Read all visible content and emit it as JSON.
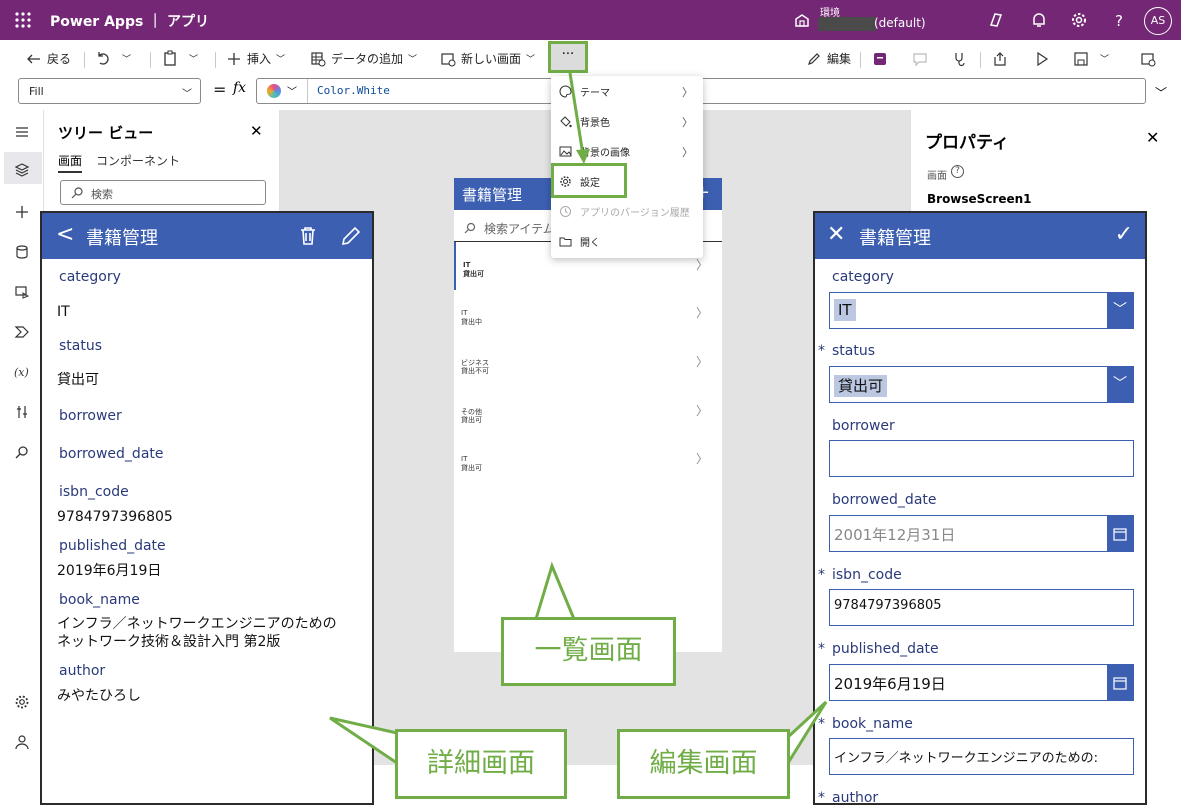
{
  "titlebar": {
    "brand": "Power Apps ｜ アプリ",
    "env_label": "環境",
    "env_name": "(default)",
    "avatar": "AS"
  },
  "commandbar": {
    "back": "戻る",
    "insert": "挿入",
    "add_data": "データの追加",
    "new_screen": "新しい画面",
    "more": "···",
    "edit": "編集"
  },
  "formula": {
    "property": "Fill",
    "equals": "=",
    "fx": "fx",
    "code": "Color.White"
  },
  "tree": {
    "title": "ツリー ビュー",
    "tab_screens": "画面",
    "tab_components": "コンポーネント",
    "search_placeholder": "検索"
  },
  "menu": {
    "items": [
      {
        "label": "テーマ",
        "icon": "palette-icon",
        "submenu": true
      },
      {
        "label": "背景色",
        "icon": "paint-bucket-icon",
        "submenu": true
      },
      {
        "label": "背景の画像",
        "icon": "image-icon",
        "submenu": true
      },
      {
        "label": "設定",
        "icon": "gear-icon",
        "submenu": false
      },
      {
        "label": "アプリのバージョン履歴",
        "icon": "history-icon",
        "submenu": false,
        "disabled": true
      },
      {
        "label": "開く",
        "icon": "folder-icon",
        "submenu": false
      }
    ]
  },
  "browse": {
    "title": "書籍管理",
    "search_placeholder": "検索アイテム",
    "rows": [
      {
        "category": "IT",
        "status": "貸出可"
      },
      {
        "category": "IT",
        "status": "貸出中"
      },
      {
        "category": "ビジネス",
        "status": "貸出不可"
      },
      {
        "category": "その他",
        "status": "貸出可"
      },
      {
        "category": "IT",
        "status": "貸出可"
      }
    ]
  },
  "props": {
    "title": "プロパティ",
    "screen_label": "画面",
    "screen_name": "BrowseScreen1"
  },
  "detail": {
    "title": "書籍管理",
    "fields": [
      {
        "label": "category",
        "value": "IT"
      },
      {
        "label": "status",
        "value": "貸出可"
      },
      {
        "label": "borrower",
        "value": ""
      },
      {
        "label": "borrowed_date",
        "value": ""
      },
      {
        "label": "isbn_code",
        "value": "9784797396805"
      },
      {
        "label": "published_date",
        "value": "2019年6月19日"
      },
      {
        "label": "book_name",
        "value": "インフラ／ネットワークエンジニアのための",
        "value2": "ネットワーク技術＆設計入門 第2版"
      },
      {
        "label": "author",
        "value": "みやたひろし"
      }
    ]
  },
  "edit": {
    "title": "書籍管理",
    "required_mark": "*",
    "category_label": "category",
    "category_value": "IT",
    "status_label": "status",
    "status_value": "貸出可",
    "borrower_label": "borrower",
    "borrowed_date_label": "borrowed_date",
    "borrowed_date_placeholder": "2001年12月31日",
    "isbn_label": "isbn_code",
    "isbn_value": "9784797396805",
    "published_label": "published_date",
    "published_value": "2019年6月19日",
    "book_name_label": "book_name",
    "book_name_value": "インフラ／ネットワークエンジニアのための:",
    "author_label": "author"
  },
  "callouts": {
    "list": "一覧画面",
    "detail": "詳細画面",
    "edit": "編集画面"
  },
  "colors": {
    "titlebar": "#742774",
    "header_blue": "#3c5fb1",
    "callout_green": "#70ad47"
  }
}
